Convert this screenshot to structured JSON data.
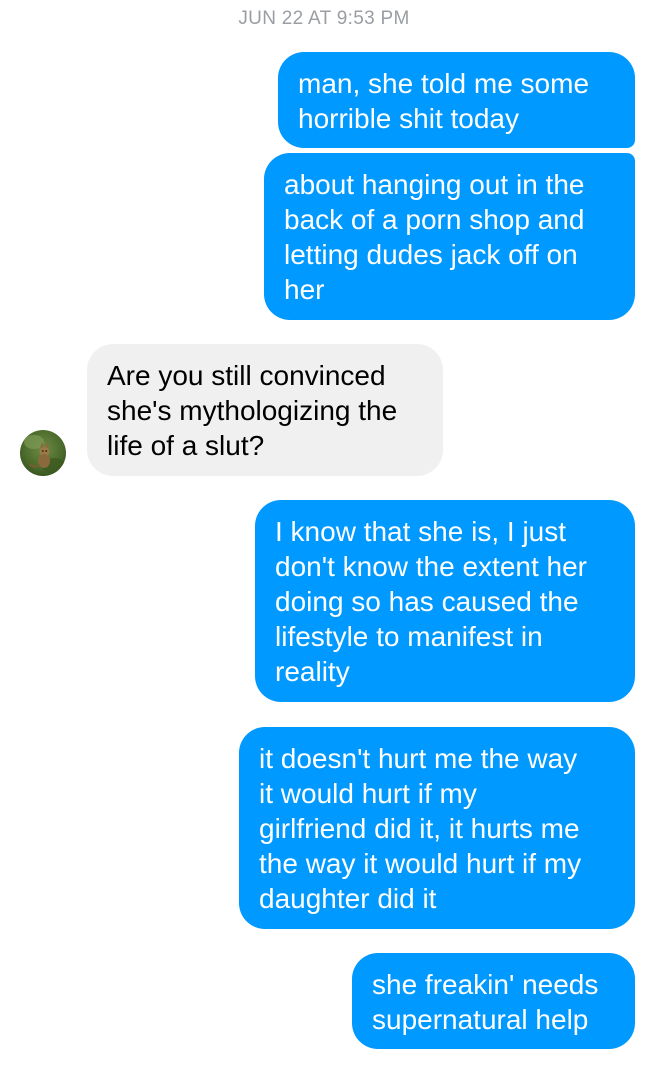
{
  "thread": {
    "timestamp": "JUN 22 AT 9:53 PM",
    "messages": [
      {
        "sender": "me",
        "text": "man, she told me some\nhorrible shit today"
      },
      {
        "sender": "me",
        "text": "about hanging out in the\nback of a porn shop and\nletting dudes jack off on\nher"
      },
      {
        "sender": "them",
        "text": "Are you still convinced\nshe's mythologizing the\nlife of a slut?"
      },
      {
        "sender": "me",
        "text": "I know that she is, I just\ndon't know the extent her\ndoing so has caused the\nlifestyle to manifest in\nreality"
      },
      {
        "sender": "me",
        "text": "it doesn't hurt me the way\nit would hurt if my\ngirlfriend did it, it hurts me\nthe way it would hurt if my\ndaughter did it"
      },
      {
        "sender": "me",
        "text": "she freakin' needs\nsupernatural help"
      }
    ]
  },
  "colors": {
    "outgoing_bubble": "#0099ff",
    "incoming_bubble": "#f1f0f0",
    "timestamp_text": "#9a9ea3"
  },
  "icons": {
    "avatar": "contact-avatar-photo"
  }
}
